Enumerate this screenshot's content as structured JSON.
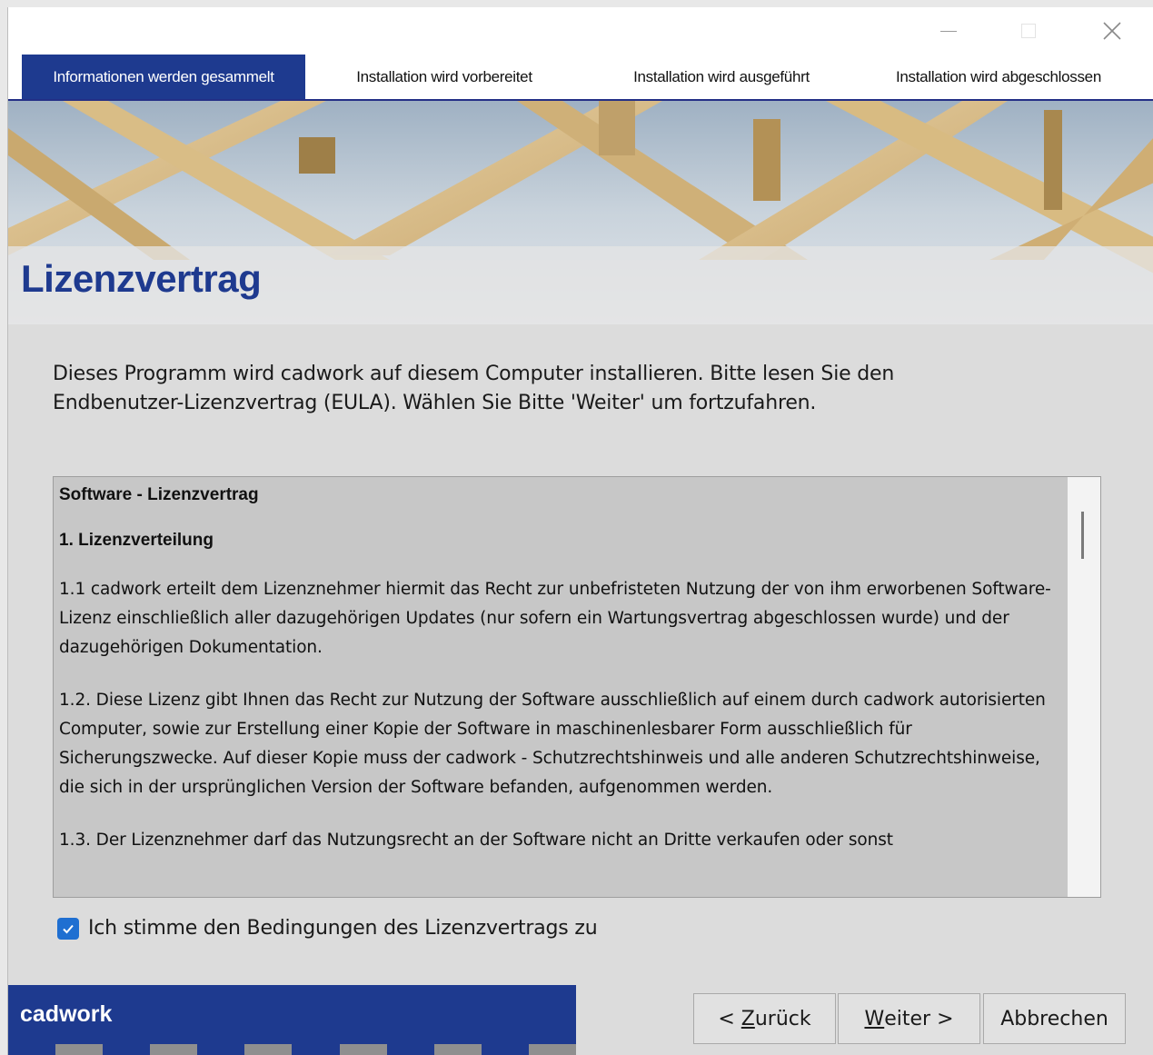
{
  "window": {
    "controls": {
      "minimize_icon": "minimize-icon",
      "maximize_icon": "maximize-icon",
      "close_icon": "close-icon"
    }
  },
  "steps": [
    {
      "label": "Informationen werden gesammelt",
      "active": true
    },
    {
      "label": "Installation wird vorbereitet",
      "active": false
    },
    {
      "label": "Installation wird ausgeführt",
      "active": false
    },
    {
      "label": "Installation wird abgeschlossen",
      "active": false
    }
  ],
  "banner": {
    "title": "Lizenzvertrag"
  },
  "description": "Dieses Programm wird cadwork auf diesem Computer installieren. Bitte lesen Sie den Endbenutzer-Lizenzvertrag (EULA). Wählen Sie Bitte 'Weiter' um fortzufahren.",
  "license": {
    "heading": "Software - Lizenzvertrag",
    "section_1": "1.  Lizenzverteilung",
    "p_1_1": "1.1   cadwork erteilt dem Lizenznehmer hiermit das Recht zur unbefristeten Nutzung der von ihm erworbenen Software-Lizenz einschließlich aller dazugehörigen Updates (nur sofern ein Wartungsvertrag abgeschlossen wurde) und der dazugehörigen Dokumentation.",
    "p_1_2": "1.2.  Diese Lizenz gibt Ihnen das Recht zur Nutzung der Software ausschließlich auf einem durch cadwork autorisierten Computer, sowie zur Erstellung einer Kopie der Software in maschinenlesbarer Form ausschließlich für Sicherungszwecke. Auf dieser Kopie muss der cadwork - Schutzrechtshinweis und alle anderen Schutzrechtshinweise, die sich in der ursprünglichen Version der Software befanden, aufgenommen werden.",
    "p_1_3": "1.3.  Der Lizenznehmer darf das Nutzungsrecht an der Software nicht an Dritte verkaufen oder sonst"
  },
  "agree": {
    "label": "Ich stimme den Bedingungen des Lizenzvertrags zu",
    "checked": true
  },
  "brand": {
    "name": "cadwork"
  },
  "buttons": {
    "back": {
      "prefix": "< ",
      "mnemonic": "Z",
      "rest": "urück"
    },
    "next": {
      "mnemonic": "W",
      "rest": "eiter >"
    },
    "cancel": "Abbrechen"
  },
  "colors": {
    "accent": "#1e3a8f",
    "checkbox": "#1f6fd1",
    "license_bg": "#c7c7c7"
  }
}
